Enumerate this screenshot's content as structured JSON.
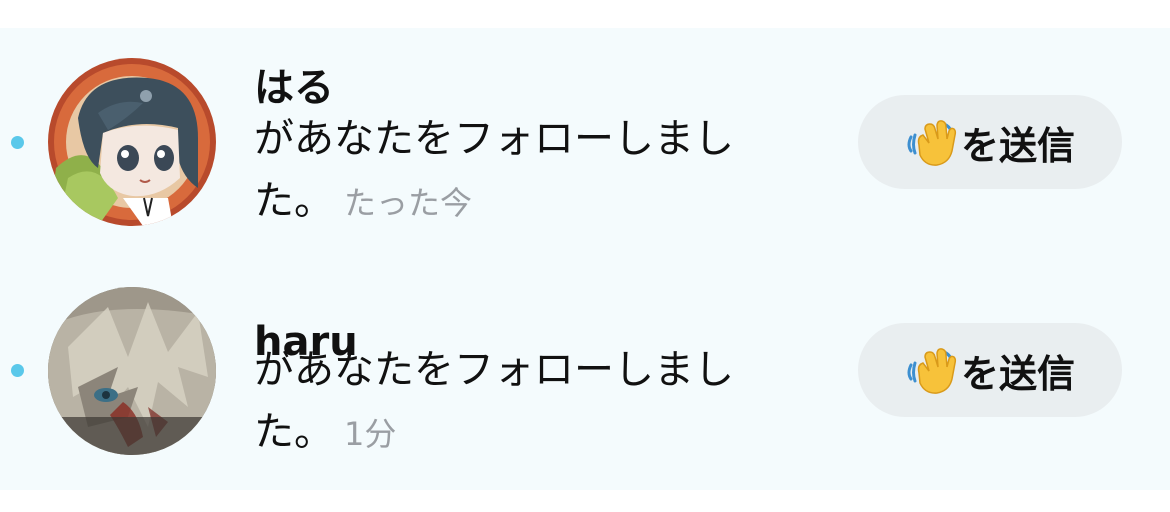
{
  "notifications": [
    {
      "username": "はる",
      "message": "があなたをフォローしました。",
      "time": "たった今",
      "unread": true,
      "avatar_icon": "avatar-anime-girl-icon",
      "button": {
        "label": "を送信",
        "icon": "waving-hand-icon"
      }
    },
    {
      "username": "haru",
      "message": "があなたをフォローしました。",
      "time": "1分",
      "unread": true,
      "avatar_icon": "avatar-anime-boy-icon",
      "button": {
        "label": "を送信",
        "icon": "waving-hand-icon"
      }
    }
  ],
  "colors": {
    "unread_dot": "#5ac8ea",
    "list_background": "#f4fbfd",
    "button_background": "#e9eef0",
    "time_text": "#9a9ea3"
  }
}
